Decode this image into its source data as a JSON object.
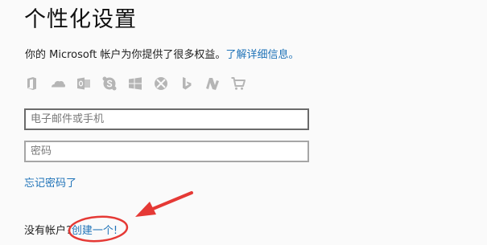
{
  "title": "个性化设置",
  "intro": {
    "text": "你的 Microsoft 帐户为你提供了很多权益。",
    "link": "了解详细信息。"
  },
  "service_icons": [
    "office-icon",
    "onedrive-icon",
    "outlook-icon",
    "skype-icon",
    "windows-icon",
    "xbox-icon",
    "bing-icon",
    "msn-icon",
    "store-icon"
  ],
  "email": {
    "placeholder": "电子邮件或手机",
    "value": ""
  },
  "password": {
    "placeholder": "密码",
    "value": ""
  },
  "forgot_password": "忘记密码了",
  "signup": {
    "prompt": "没有帐户?",
    "link": "创建一个!"
  },
  "colors": {
    "link": "#1f73b8",
    "icon": "#b5b5b5",
    "annotation": "#e53935",
    "background": "#fafafa"
  }
}
